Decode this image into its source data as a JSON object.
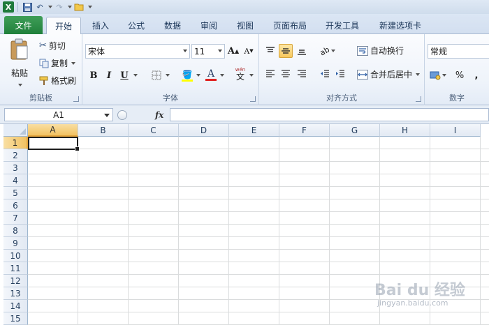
{
  "qat": {
    "app_icon_letter": "X"
  },
  "tabs": [
    "文件",
    "开始",
    "插入",
    "公式",
    "数据",
    "审阅",
    "视图",
    "页面布局",
    "开发工具",
    "新建选项卡"
  ],
  "clipboard": {
    "paste": "粘贴",
    "cut": "剪切",
    "copy": "复制",
    "format_painter": "格式刷",
    "label": "剪贴板"
  },
  "font": {
    "name": "宋体",
    "size": "11",
    "bold": "B",
    "italic": "I",
    "underline": "U",
    "font_color_letter": "A",
    "grow": "A",
    "shrink": "A",
    "phonetic": "文",
    "label": "字体"
  },
  "alignment": {
    "wrap_text": "自动换行",
    "merge_center": "合并后居中",
    "label": "对齐方式"
  },
  "number": {
    "format": "常规",
    "percent": "%",
    "comma": ",",
    "label": "数字"
  },
  "formula_bar": {
    "name_box": "A1",
    "fx": "fx",
    "value": ""
  },
  "columns": [
    "A",
    "B",
    "C",
    "D",
    "E",
    "F",
    "G",
    "H",
    "I"
  ],
  "rows": [
    "1",
    "2",
    "3",
    "4",
    "5",
    "6",
    "7",
    "8",
    "9",
    "10",
    "11",
    "12",
    "13",
    "14",
    "15"
  ],
  "selection": {
    "column": "A",
    "row": "1"
  },
  "watermark": {
    "text": "Bai du 经验",
    "url": "jingyan.baidu.com"
  },
  "colors": {
    "accent_file_tab": "#20803b",
    "selection_header": "#f2c262",
    "highlight_yellow": "#ffff00",
    "font_red": "#e02020"
  }
}
